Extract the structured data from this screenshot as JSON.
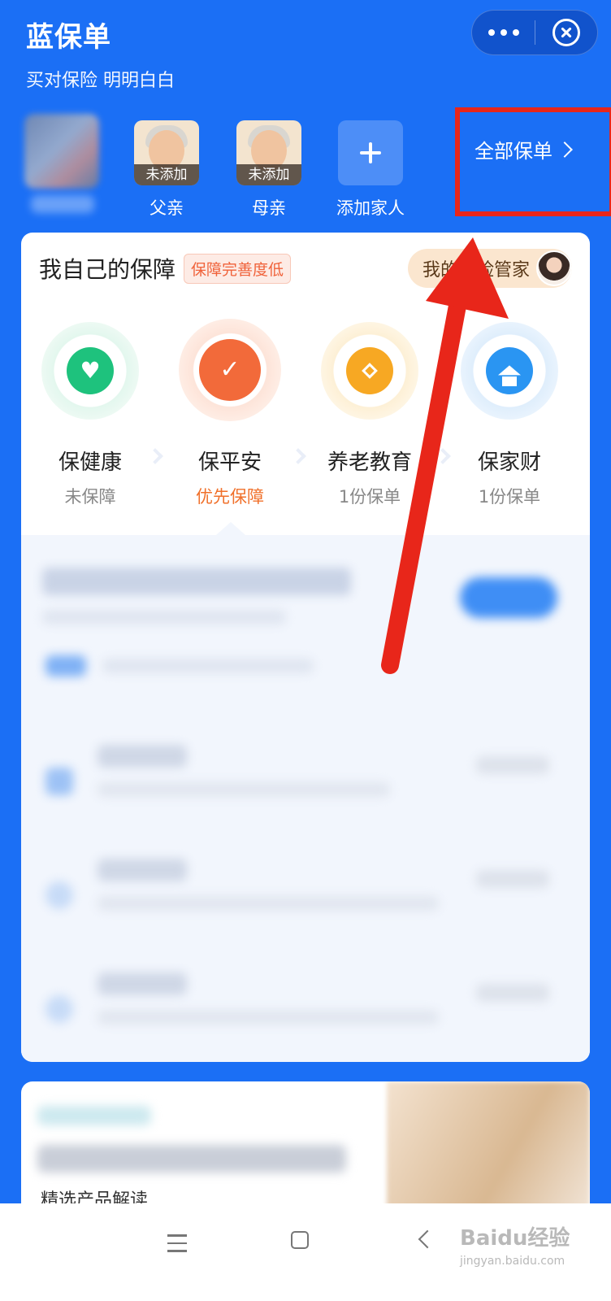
{
  "app": {
    "title": "蓝保单",
    "slogan": "买对保险 明明白白"
  },
  "family": {
    "members": [
      {
        "tag": "未添加",
        "name": "父亲"
      },
      {
        "tag": "未添加",
        "name": "母亲"
      }
    ],
    "add_label": "添加家人",
    "all_policies_label": "全部保单"
  },
  "card": {
    "title": "我自己的保障",
    "badge": "保障完善度低",
    "butler_label": "我的保险管家",
    "categories": [
      {
        "name": "保健康",
        "status": "未保障",
        "color": "#1ec27d"
      },
      {
        "name": "保平安",
        "status": "优先保障",
        "color": "#f26a3a"
      },
      {
        "name": "养老教育",
        "status": "1份保单",
        "color": "#f7a823"
      },
      {
        "name": "保家财",
        "status": "1份保单",
        "color": "#2a95f2"
      }
    ]
  },
  "promo": {
    "caption": "精选产品解读"
  },
  "watermark": {
    "brand": "Baidu经验",
    "url": "jingyan.baidu.com"
  },
  "colors": {
    "brand_blue": "#1b6ff5",
    "annotation_red": "#e8261a"
  }
}
